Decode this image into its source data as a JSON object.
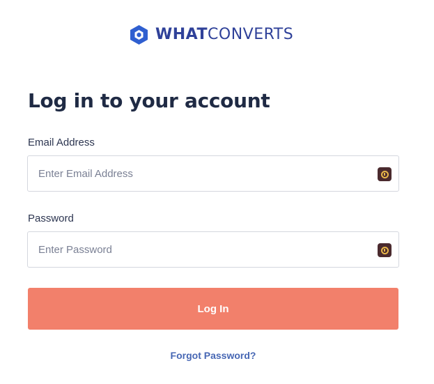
{
  "brand": {
    "name_bold": "WHAT",
    "name_light": "CONVERTS",
    "color": "#2f4199",
    "icon": "hexagon-logo-icon"
  },
  "form": {
    "title": "Log in to your account",
    "email": {
      "label": "Email Address",
      "placeholder": "Enter Email Address",
      "value": "",
      "icon": "password-manager-icon"
    },
    "password": {
      "label": "Password",
      "placeholder": "Enter Password",
      "value": "",
      "icon": "password-manager-icon"
    },
    "submit_label": "Log In",
    "submit_color": "#f2806b",
    "forgot_label": "Forgot Password?",
    "link_color": "#4767b4"
  }
}
